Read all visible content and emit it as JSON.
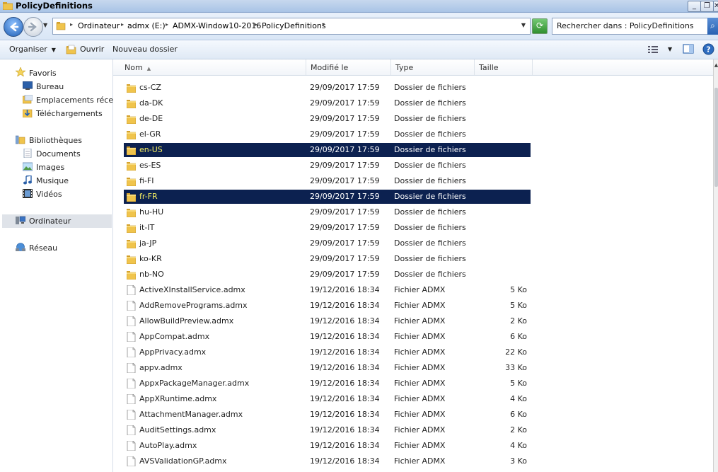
{
  "window": {
    "title": "PolicyDefinitions",
    "minimize": "_",
    "restore": "❐",
    "close": "✕"
  },
  "address": {
    "breadcrumbs": [
      "Ordinateur",
      "admx (E:)",
      "ADMX-Window10-2016",
      "PolicyDefinitions"
    ],
    "search_placeholder": "Rechercher dans : PolicyDefinitions"
  },
  "toolbar": {
    "organize": "Organiser",
    "open": "Ouvrir",
    "new_folder": "Nouveau dossier"
  },
  "sidebar": {
    "favorites": "Favoris",
    "desktop": "Bureau",
    "recent": "Emplacements récents",
    "downloads": "Téléchargements",
    "libraries": "Bibliothèques",
    "documents": "Documents",
    "images": "Images",
    "music": "Musique",
    "videos": "Vidéos",
    "computer": "Ordinateur",
    "network": "Réseau"
  },
  "columns": {
    "name": "Nom",
    "modified": "Modifié le",
    "type": "Type",
    "size": "Taille"
  },
  "colors": {
    "selection": "#0c2150",
    "highlight_text": "#f7f061",
    "folder": "#e8b73a"
  },
  "files": [
    {
      "name": "cs-CZ",
      "modified": "29/09/2017 17:59",
      "type": "Dossier de fichiers",
      "size": "",
      "kind": "folder",
      "selected": false
    },
    {
      "name": "da-DK",
      "modified": "29/09/2017 17:59",
      "type": "Dossier de fichiers",
      "size": "",
      "kind": "folder",
      "selected": false
    },
    {
      "name": "de-DE",
      "modified": "29/09/2017 17:59",
      "type": "Dossier de fichiers",
      "size": "",
      "kind": "folder",
      "selected": false
    },
    {
      "name": "el-GR",
      "modified": "29/09/2017 17:59",
      "type": "Dossier de fichiers",
      "size": "",
      "kind": "folder",
      "selected": false
    },
    {
      "name": "en-US",
      "modified": "29/09/2017 17:59",
      "type": "Dossier de fichiers",
      "size": "",
      "kind": "folder",
      "selected": true
    },
    {
      "name": "es-ES",
      "modified": "29/09/2017 17:59",
      "type": "Dossier de fichiers",
      "size": "",
      "kind": "folder",
      "selected": false
    },
    {
      "name": "fi-FI",
      "modified": "29/09/2017 17:59",
      "type": "Dossier de fichiers",
      "size": "",
      "kind": "folder",
      "selected": false
    },
    {
      "name": "fr-FR",
      "modified": "29/09/2017 17:59",
      "type": "Dossier de fichiers",
      "size": "",
      "kind": "folder",
      "selected": true
    },
    {
      "name": "hu-HU",
      "modified": "29/09/2017 17:59",
      "type": "Dossier de fichiers",
      "size": "",
      "kind": "folder",
      "selected": false
    },
    {
      "name": "it-IT",
      "modified": "29/09/2017 17:59",
      "type": "Dossier de fichiers",
      "size": "",
      "kind": "folder",
      "selected": false
    },
    {
      "name": "ja-JP",
      "modified": "29/09/2017 17:59",
      "type": "Dossier de fichiers",
      "size": "",
      "kind": "folder",
      "selected": false
    },
    {
      "name": "ko-KR",
      "modified": "29/09/2017 17:59",
      "type": "Dossier de fichiers",
      "size": "",
      "kind": "folder",
      "selected": false
    },
    {
      "name": "nb-NO",
      "modified": "29/09/2017 17:59",
      "type": "Dossier de fichiers",
      "size": "",
      "kind": "folder",
      "selected": false
    },
    {
      "name": "ActiveXInstallService.admx",
      "modified": "19/12/2016 18:34",
      "type": "Fichier ADMX",
      "size": "5 Ko",
      "kind": "file",
      "selected": false
    },
    {
      "name": "AddRemovePrograms.admx",
      "modified": "19/12/2016 18:34",
      "type": "Fichier ADMX",
      "size": "5 Ko",
      "kind": "file",
      "selected": false
    },
    {
      "name": "AllowBuildPreview.admx",
      "modified": "19/12/2016 18:34",
      "type": "Fichier ADMX",
      "size": "2 Ko",
      "kind": "file",
      "selected": false
    },
    {
      "name": "AppCompat.admx",
      "modified": "19/12/2016 18:34",
      "type": "Fichier ADMX",
      "size": "6 Ko",
      "kind": "file",
      "selected": false
    },
    {
      "name": "AppPrivacy.admx",
      "modified": "19/12/2016 18:34",
      "type": "Fichier ADMX",
      "size": "22 Ko",
      "kind": "file",
      "selected": false
    },
    {
      "name": "appv.admx",
      "modified": "19/12/2016 18:34",
      "type": "Fichier ADMX",
      "size": "33 Ko",
      "kind": "file",
      "selected": false
    },
    {
      "name": "AppxPackageManager.admx",
      "modified": "19/12/2016 18:34",
      "type": "Fichier ADMX",
      "size": "5 Ko",
      "kind": "file",
      "selected": false
    },
    {
      "name": "AppXRuntime.admx",
      "modified": "19/12/2016 18:34",
      "type": "Fichier ADMX",
      "size": "4 Ko",
      "kind": "file",
      "selected": false
    },
    {
      "name": "AttachmentManager.admx",
      "modified": "19/12/2016 18:34",
      "type": "Fichier ADMX",
      "size": "6 Ko",
      "kind": "file",
      "selected": false
    },
    {
      "name": "AuditSettings.admx",
      "modified": "19/12/2016 18:34",
      "type": "Fichier ADMX",
      "size": "2 Ko",
      "kind": "file",
      "selected": false
    },
    {
      "name": "AutoPlay.admx",
      "modified": "19/12/2016 18:34",
      "type": "Fichier ADMX",
      "size": "4 Ko",
      "kind": "file",
      "selected": false
    },
    {
      "name": "AVSValidationGP.admx",
      "modified": "19/12/2016 18:34",
      "type": "Fichier ADMX",
      "size": "3 Ko",
      "kind": "file",
      "selected": false
    }
  ]
}
